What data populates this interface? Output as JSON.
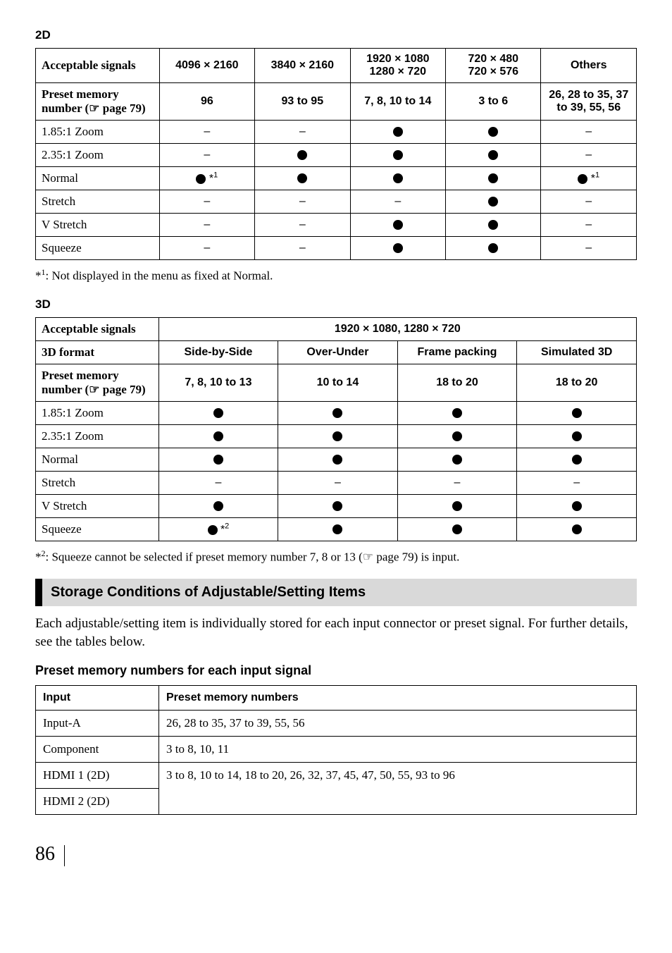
{
  "section_2d": {
    "label": "2D",
    "acceptable_signals_label": "Acceptable signals",
    "preset_memory_label_1": "Preset memory",
    "preset_memory_label_2": "number (",
    "preset_memory_label_3": " page 79)",
    "cols": [
      "4096 × 2160",
      "3840 × 2160",
      "1920 × 1080\n1280 × 720",
      "720 × 480\n720 × 576",
      "Others"
    ],
    "preset_vals": [
      "96",
      "93 to 95",
      "7, 8, 10 to 14",
      "3 to 6",
      "26, 28 to 35, 37 to 39, 55, 56"
    ],
    "rows": [
      {
        "name": "1.85:1 Zoom",
        "cells": [
          "–",
          "–",
          "●",
          "●",
          "–"
        ]
      },
      {
        "name": "2.35:1 Zoom",
        "cells": [
          "–",
          "●",
          "●",
          "●",
          "–"
        ]
      },
      {
        "name": "Normal",
        "cells": [
          "●*1",
          "●",
          "●",
          "●",
          "●*1"
        ]
      },
      {
        "name": "Stretch",
        "cells": [
          "–",
          "–",
          "–",
          "●",
          "–"
        ]
      },
      {
        "name": "V Stretch",
        "cells": [
          "–",
          "–",
          "●",
          "●",
          "–"
        ]
      },
      {
        "name": "Squeeze",
        "cells": [
          "–",
          "–",
          "●",
          "●",
          "–"
        ]
      }
    ],
    "footnote_sup": "1",
    "footnote_text": ":  Not displayed in the menu as fixed at Normal."
  },
  "section_3d": {
    "label": "3D",
    "acceptable_signals_label": "Acceptable signals",
    "resolution": "1920 × 1080, 1280 × 720",
    "format_label": "3D format",
    "formats": [
      "Side-by-Side",
      "Over-Under",
      "Frame packing",
      "Simulated 3D"
    ],
    "preset_memory_label_1": "Preset memory",
    "preset_memory_label_2": "number (",
    "preset_memory_label_3": " page 79)",
    "preset_vals": [
      "7, 8, 10 to 13",
      "10 to 14",
      "18 to 20",
      "18 to 20"
    ],
    "rows": [
      {
        "name": "1.85:1 Zoom",
        "cells": [
          "●",
          "●",
          "●",
          "●"
        ]
      },
      {
        "name": "2.35:1 Zoom",
        "cells": [
          "●",
          "●",
          "●",
          "●"
        ]
      },
      {
        "name": "Normal",
        "cells": [
          "●",
          "●",
          "●",
          "●"
        ]
      },
      {
        "name": "Stretch",
        "cells": [
          "–",
          "–",
          "–",
          "–"
        ]
      },
      {
        "name": "V Stretch",
        "cells": [
          "●",
          "●",
          "●",
          "●"
        ]
      },
      {
        "name": "Squeeze",
        "cells": [
          "●*2",
          "●",
          "●",
          "●"
        ]
      }
    ],
    "footnote_sup": "2",
    "footnote_text": ":  Squeeze cannot be selected if preset memory number 7, 8 or 13  (",
    "footnote_text2": " page 79) is input."
  },
  "storage": {
    "heading": "Storage Conditions of Adjustable/Setting Items",
    "body": "Each adjustable/setting item is individually stored for each input connector or preset signal. For further details, see the tables below.",
    "subheading": "Preset memory numbers for each input signal",
    "col1": "Input",
    "col2": "Preset memory numbers",
    "rows": [
      {
        "input": "Input-A",
        "nums": "26, 28 to 35, 37 to 39, 55, 56"
      },
      {
        "input": "Component",
        "nums": "3 to 8, 10, 11"
      },
      {
        "input": "HDMI 1 (2D)",
        "nums": "3 to 8, 10 to 14, 18 to 20, 26, 32, 37, 45, 47, 50, 55, 93 to 96"
      },
      {
        "input": "HDMI 2 (2D)",
        "nums": ""
      }
    ]
  },
  "page_number": "86",
  "pointer_icon": "☞"
}
